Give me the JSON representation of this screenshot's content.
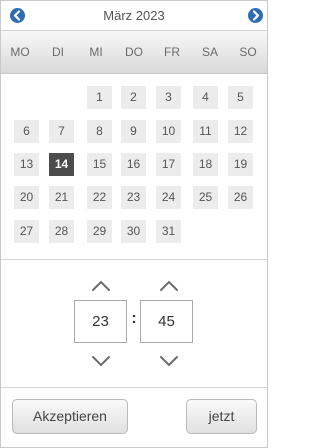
{
  "calendar": {
    "month_label": "März 2023",
    "prev_icon": "chevron-left-icon",
    "next_icon": "chevron-right-icon",
    "weekdays": [
      "MO",
      "DI",
      "MI",
      "DO",
      "FR",
      "SA",
      "SO"
    ],
    "first_weekday_index": 2,
    "days": [
      "1",
      "2",
      "3",
      "4",
      "5",
      "6",
      "7",
      "8",
      "9",
      "10",
      "11",
      "12",
      "13",
      "14",
      "15",
      "16",
      "17",
      "18",
      "19",
      "20",
      "21",
      "22",
      "23",
      "24",
      "25",
      "26",
      "27",
      "28",
      "29",
      "30",
      "31"
    ],
    "selected_day": "14",
    "accent_color": "#2f6db3",
    "selected_color": "#4c4c4c"
  },
  "time": {
    "hours": "23",
    "minutes": "45",
    "separator": ":",
    "up_icon": "chevron-up-icon",
    "down_icon": "chevron-down-icon"
  },
  "buttons": {
    "accept_label": "Akzeptieren",
    "now_label": "jetzt"
  }
}
